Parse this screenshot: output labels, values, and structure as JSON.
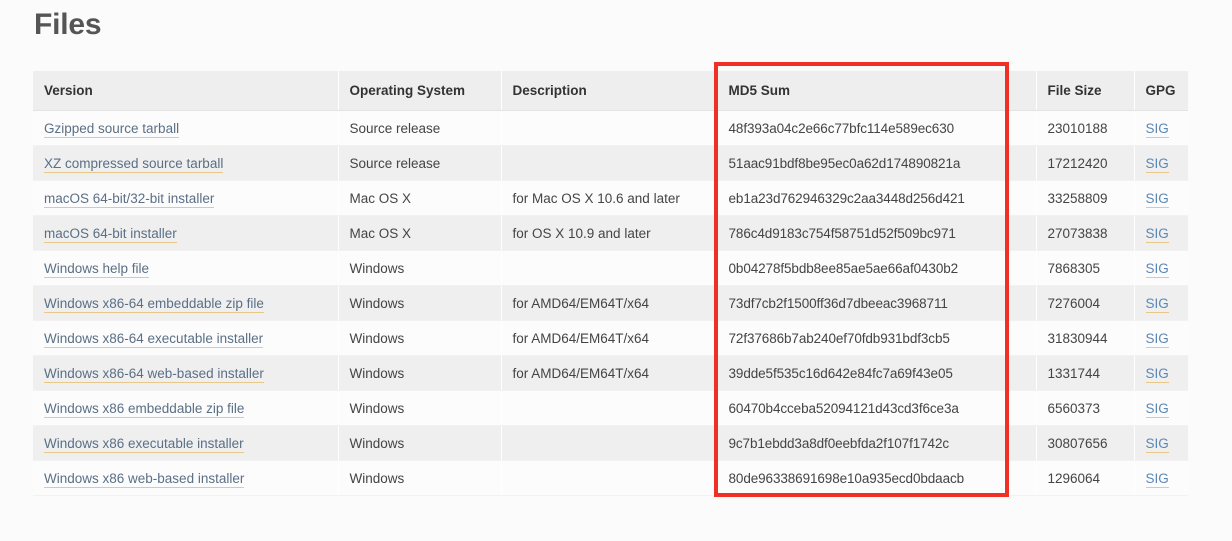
{
  "page": {
    "title": "Files",
    "background_color": "#fbfbfb",
    "title_color": "#555555"
  },
  "annotation": {
    "type": "rectangle-highlight",
    "color": "#ee3124",
    "target_column": "MD5 Sum"
  },
  "table": {
    "name": "files-table",
    "columns": [
      {
        "key": "version",
        "label": "Version"
      },
      {
        "key": "operating_system",
        "label": "Operating System"
      },
      {
        "key": "description",
        "label": "Description"
      },
      {
        "key": "md5_sum",
        "label": "MD5 Sum"
      },
      {
        "key": "file_size",
        "label": "File Size"
      },
      {
        "key": "gpg",
        "label": "GPG"
      }
    ],
    "rows": [
      {
        "version": "Gzipped source tarball",
        "operating_system": "Source release",
        "description": "",
        "md5_sum": "48f393a04c2e66c77bfc114e589ec630",
        "file_size": "23010188",
        "gpg": "SIG"
      },
      {
        "version": "XZ compressed source tarball",
        "operating_system": "Source release",
        "description": "",
        "md5_sum": "51aac91bdf8be95ec0a62d174890821a",
        "file_size": "17212420",
        "gpg": "SIG"
      },
      {
        "version": "macOS 64-bit/32-bit installer",
        "operating_system": "Mac OS X",
        "description": "for Mac OS X 10.6 and later",
        "md5_sum": "eb1a23d762946329c2aa3448d256d421",
        "file_size": "33258809",
        "gpg": "SIG"
      },
      {
        "version": "macOS 64-bit installer",
        "operating_system": "Mac OS X",
        "description": "for OS X 10.9 and later",
        "md5_sum": "786c4d9183c754f58751d52f509bc971",
        "file_size": "27073838",
        "gpg": "SIG"
      },
      {
        "version": "Windows help file",
        "operating_system": "Windows",
        "description": "",
        "md5_sum": "0b04278f5bdb8ee85ae5ae66af0430b2",
        "file_size": "7868305",
        "gpg": "SIG"
      },
      {
        "version": "Windows x86-64 embeddable zip file",
        "operating_system": "Windows",
        "description": "for AMD64/EM64T/x64",
        "md5_sum": "73df7cb2f1500ff36d7dbeeac3968711",
        "file_size": "7276004",
        "gpg": "SIG"
      },
      {
        "version": "Windows x86-64 executable installer",
        "operating_system": "Windows",
        "description": "for AMD64/EM64T/x64",
        "md5_sum": "72f37686b7ab240ef70fdb931bdf3cb5",
        "file_size": "31830944",
        "gpg": "SIG"
      },
      {
        "version": "Windows x86-64 web-based installer",
        "operating_system": "Windows",
        "description": "for AMD64/EM64T/x64",
        "md5_sum": "39dde5f535c16d642e84fc7a69f43e05",
        "file_size": "1331744",
        "gpg": "SIG"
      },
      {
        "version": "Windows x86 embeddable zip file",
        "operating_system": "Windows",
        "description": "",
        "md5_sum": "60470b4cceba52094121d43cd3f6ce3a",
        "file_size": "6560373",
        "gpg": "SIG"
      },
      {
        "version": "Windows x86 executable installer",
        "operating_system": "Windows",
        "description": "",
        "md5_sum": "9c7b1ebdd3a8df0eebfda2f107f1742c",
        "file_size": "30807656",
        "gpg": "SIG"
      },
      {
        "version": "Windows x86 web-based installer",
        "operating_system": "Windows",
        "description": "",
        "md5_sum": "80de96338691698e10a935ecd0bdaacb",
        "file_size": "1296064",
        "gpg": "SIG"
      }
    ]
  }
}
